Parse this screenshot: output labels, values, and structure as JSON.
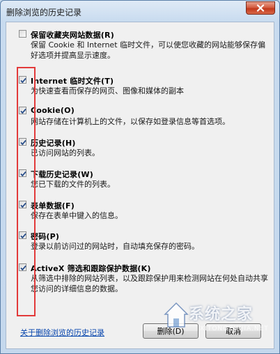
{
  "window": {
    "title": "删除浏览的历史记录"
  },
  "options": [
    {
      "title": "保留收藏夹网站数据(R)",
      "desc": "保留 Cookie 和 Internet 临时文件，可以使您收藏的网站能够保存偏好选项并提高显示速度。",
      "checked": false
    },
    {
      "title": "Internet 临时文件(T)",
      "desc": "为快速查看而保存的网页、图像和媒体的副本",
      "checked": true
    },
    {
      "title": "Cookie(O)",
      "desc": "网站存储在计算机上的文件，以保存如登录信息等首选项。",
      "checked": true
    },
    {
      "title": "历史记录(H)",
      "desc": "已访问网站的列表。",
      "checked": true
    },
    {
      "title": "下载历史记录(W)",
      "desc": "您已下载的文件的列表。",
      "checked": true
    },
    {
      "title": "表单数据(F)",
      "desc": "保存在表单中键入的信息。",
      "checked": true
    },
    {
      "title": "密码(P)",
      "desc": "登录以前访问过的网站时，自动填充保存的密码。",
      "checked": true
    },
    {
      "title": "ActiveX 筛选和跟踪保护数据(K)",
      "desc": "从筛选中排除的网站列表，以及跟踪保护用来检测网站在何处自动共享您访问的详细信息的数据。",
      "checked": true
    }
  ],
  "footer": {
    "link": "关于删除浏览的历史记录",
    "delete_button": "删除(D)",
    "cancel_button": "取消"
  },
  "watermark": {
    "main": "系统之家",
    "sub": "XITONGZHIJIA.NET"
  }
}
